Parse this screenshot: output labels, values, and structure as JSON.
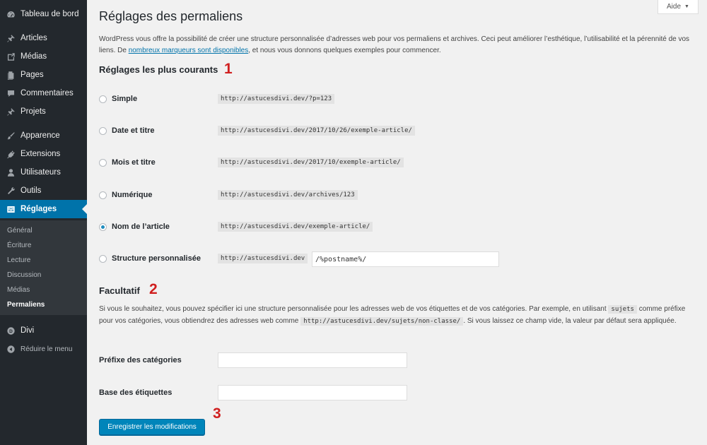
{
  "sidebar": {
    "dashboard": "Tableau de bord",
    "posts": "Articles",
    "media": "Médias",
    "pages": "Pages",
    "comments": "Commentaires",
    "projects": "Projets",
    "appearance": "Apparence",
    "plugins": "Extensions",
    "users": "Utilisateurs",
    "tools": "Outils",
    "settings": "Réglages",
    "submenu": [
      "Général",
      "Écriture",
      "Lecture",
      "Discussion",
      "Médias",
      "Permaliens"
    ],
    "divi": "Divi",
    "collapse": "Réduire le menu"
  },
  "header": {
    "help": "Aide",
    "title": "Réglages des permaliens"
  },
  "intro": {
    "before": "WordPress vous offre la possibilité de créer une structure personnalisée d’adresses web pour vos permaliens et archives. Ceci peut améliorer l’esthétique, l’utilisabilité et la pérennité de vos liens. De ",
    "link": "nombreux marqueurs sont disponibles",
    "after": ", et nous vous donnons quelques exemples pour commencer."
  },
  "common": {
    "heading": "Réglages les plus courants",
    "marker": "1",
    "options": [
      {
        "label": "Simple",
        "example": "http://astucesdivi.dev/?p=123",
        "checked": false
      },
      {
        "label": "Date et titre",
        "example": "http://astucesdivi.dev/2017/10/26/exemple-article/",
        "checked": false
      },
      {
        "label": "Mois et titre",
        "example": "http://astucesdivi.dev/2017/10/exemple-article/",
        "checked": false
      },
      {
        "label": "Numérique",
        "example": "http://astucesdivi.dev/archives/123",
        "checked": false
      },
      {
        "label": "Nom de l’article",
        "example": "http://astucesdivi.dev/exemple-article/",
        "checked": true
      }
    ],
    "custom": {
      "label": "Structure personnalisée",
      "base": "http://astucesdivi.dev",
      "value": "/%postname%/"
    }
  },
  "optional": {
    "heading": "Facultatif",
    "marker": "2",
    "text1": "Si vous le souhaitez, vous pouvez spécifier ici une structure personnalisée pour les adresses web de vos étiquettes et de vos catégories. Par exemple, en utilisant ",
    "code1": "sujets",
    "text2": " comme préfixe pour vos catégories, vous obtiendrez des adresses web comme ",
    "code2": "http://astucesdivi.dev/sujets/non-classe/",
    "text3": ". Si vous laissez ce champ vide, la valeur par défaut sera appliquée.",
    "category_label": "Préfixe des catégories",
    "category_value": "",
    "tag_label": "Base des étiquettes",
    "tag_value": ""
  },
  "footer": {
    "save": "Enregistrer les modifications",
    "marker": "3"
  },
  "colors": {
    "sidebar_bg": "#23282d",
    "accent": "#0073aa",
    "button": "#0085ba",
    "marker": "#d01f1f"
  }
}
